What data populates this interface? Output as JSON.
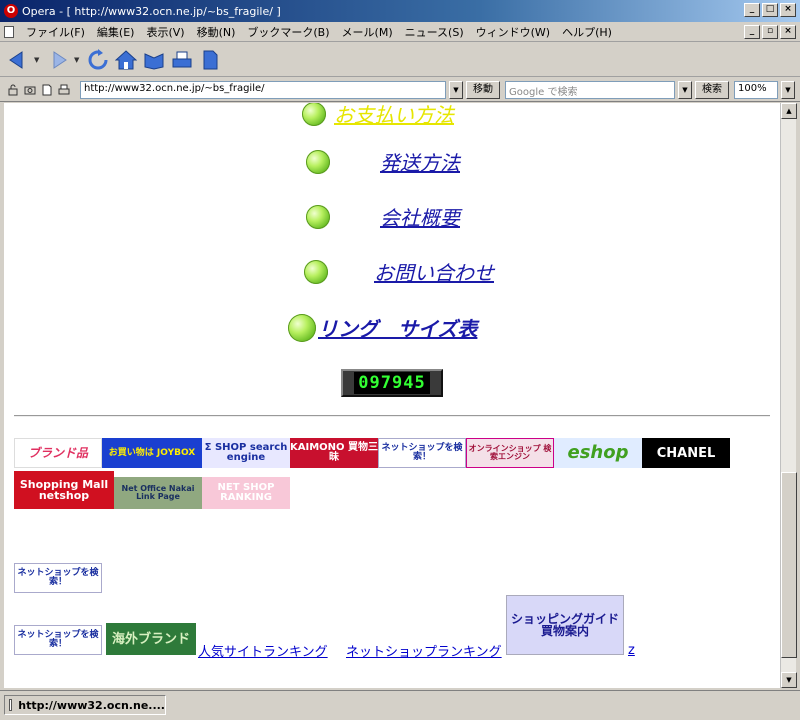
{
  "window": {
    "title": "Opera - [ http://www32.ocn.ne.jp/~bs_fragile/ ]",
    "min_glyph": "_",
    "max_glyph": "□",
    "close_glyph": "×",
    "restore_glyph": "▫"
  },
  "menu": {
    "items": [
      "ファイル(F)",
      "編集(E)",
      "表示(V)",
      "移動(N)",
      "ブックマーク(B)",
      "メール(M)",
      "ニュース(S)",
      "ウィンドウ(W)",
      "ヘルプ(H)"
    ]
  },
  "toolbar": {
    "icons": [
      "back-icon",
      "forward-icon",
      "reload-icon",
      "home-icon",
      "hotlist-icon",
      "print-icon",
      "page-icon"
    ]
  },
  "address": {
    "url": "http://www32.ocn.ne.jp/~bs_fragile/",
    "go_label": "移動",
    "search_placeholder": "Google で検索",
    "search_label": "検索",
    "zoom": "100%"
  },
  "page": {
    "nav": [
      {
        "label": "お支払い方法"
      },
      {
        "label": "発送方法"
      },
      {
        "label": "会社概要"
      },
      {
        "label": "お問い合わせ"
      },
      {
        "label": "リング　サイズ表"
      }
    ],
    "counter": "097945",
    "banners_row1": [
      {
        "text": "ブランド品"
      },
      {
        "text": "お買い物は JOYBOX"
      },
      {
        "text": "Σ SHOP search engine"
      },
      {
        "text": "KAIMONO 買物三昧"
      },
      {
        "text": "ネットショップを検索！"
      },
      {
        "text": "オンラインショップ 検索エンジン"
      },
      {
        "text": "eshop"
      },
      {
        "text": "CHANEL"
      }
    ],
    "banners_row2": [
      {
        "text": "Shopping Mall netshop"
      },
      {
        "text": "Net Office Nakai Link Page"
      },
      {
        "text": "NET SHOP RANKING"
      }
    ],
    "banner_single": {
      "text": "ネットショップを検索！"
    },
    "banners_row3": [
      {
        "text": "ネットショップを検索！"
      },
      {
        "text": "海外ブランド"
      },
      {
        "text": "ショッピングガイド 買物案内"
      }
    ],
    "links": {
      "ranking1": "人気サイトランキング",
      "ranking2": "ネットショップランキング",
      "z": "z"
    }
  },
  "status": {
    "text": "http://www32.ocn.ne...."
  },
  "colors": {
    "link": "#1a1aa8",
    "ball": "#88dd33",
    "counter": "#33ff33"
  }
}
